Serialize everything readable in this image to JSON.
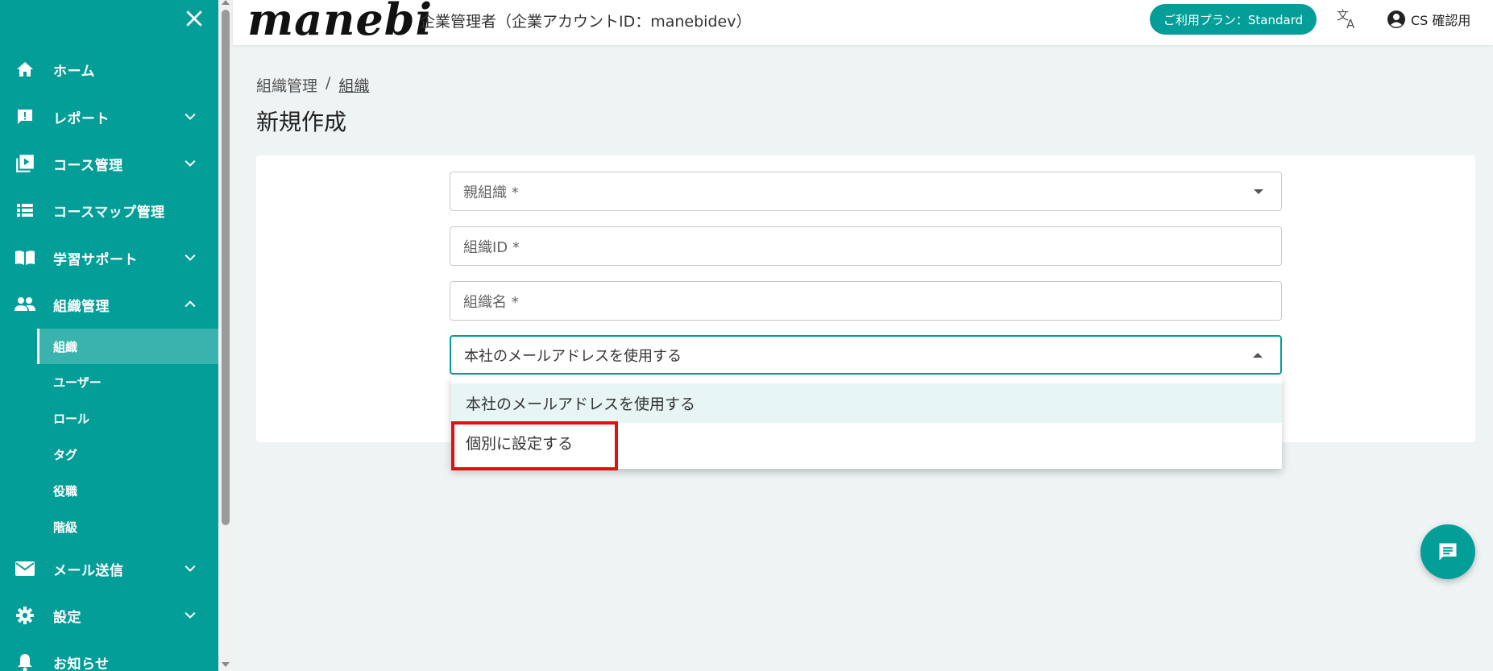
{
  "colors": {
    "brand": "#039e98",
    "highlight": "#e21010",
    "background": "#eef3f3"
  },
  "header": {
    "logo": "manebi",
    "company": "企業管理者（企業アカウントID：manebidev）",
    "plan": "ご利用プラン：Standard",
    "user": "CS 確認用"
  },
  "sidebar": {
    "items": [
      {
        "label": "ホーム",
        "icon": "home-icon"
      },
      {
        "label": "レポート",
        "icon": "report-icon"
      },
      {
        "label": "コース管理",
        "icon": "course-icon"
      },
      {
        "label": "コースマップ管理",
        "icon": "list-icon"
      },
      {
        "label": "学習サポート",
        "icon": "book-icon"
      },
      {
        "label": "組織管理",
        "icon": "people-icon"
      }
    ],
    "sub_items": [
      {
        "label": "組織"
      },
      {
        "label": "ユーザー"
      },
      {
        "label": "ロール"
      },
      {
        "label": "タグ"
      },
      {
        "label": "役職"
      },
      {
        "label": "階級"
      }
    ],
    "bottom_items": [
      {
        "label": "メール送信",
        "icon": "mail-icon"
      },
      {
        "label": "設定",
        "icon": "gear-icon"
      },
      {
        "label": "お知らせ",
        "icon": "bell-icon"
      }
    ]
  },
  "breadcrumb": {
    "parent": "組織管理",
    "separator": "/",
    "current": "組織"
  },
  "page_title": "新規作成",
  "form": {
    "parent_org_placeholder": "親組織 *",
    "org_id_placeholder": "組織ID *",
    "org_name_placeholder": "組織名 *",
    "email_select_value": "本社のメールアドレスを使用する",
    "email_options": [
      "本社のメールアドレスを使用する",
      "個別に設定する"
    ]
  }
}
